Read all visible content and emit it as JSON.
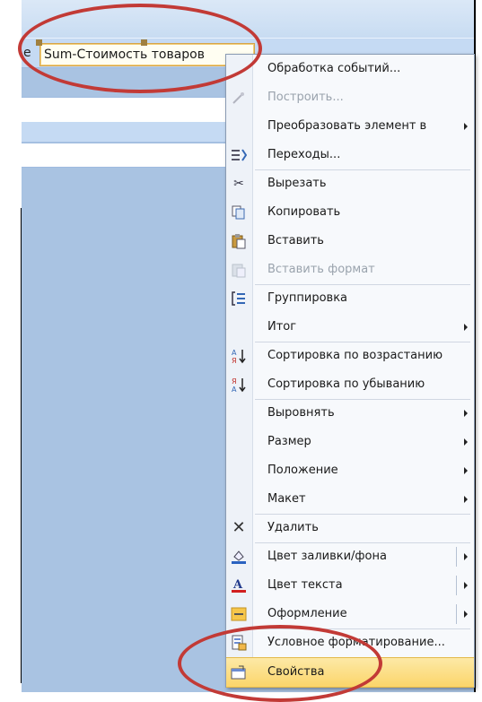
{
  "editor": {
    "left_label": "e",
    "field_text": "Sum-Стоимость товаров"
  },
  "menu": {
    "items": [
      {
        "label": "Обработка событий...",
        "icon": "none",
        "submenu": false,
        "state": "normal"
      },
      {
        "label": "Построить...",
        "icon": "build-wand-icon",
        "submenu": false,
        "state": "disabled"
      },
      {
        "label": "Преобразовать элемент в",
        "icon": "none",
        "submenu": true,
        "state": "normal"
      },
      {
        "label": "Переходы...",
        "icon": "tab-order-icon",
        "submenu": false,
        "state": "normal"
      },
      {
        "label": "Вырезать",
        "icon": "scissors-icon",
        "submenu": false,
        "state": "normal"
      },
      {
        "label": "Копировать",
        "icon": "copy-icon",
        "submenu": false,
        "state": "normal"
      },
      {
        "label": "Вставить",
        "icon": "paste-icon",
        "submenu": false,
        "state": "normal"
      },
      {
        "label": "Вставить формат",
        "icon": "paste-format-icon",
        "submenu": false,
        "state": "disabled"
      },
      {
        "label": "Группировка",
        "icon": "grouping-icon",
        "submenu": false,
        "state": "normal"
      },
      {
        "label": "Итог",
        "icon": "none",
        "submenu": true,
        "state": "normal"
      },
      {
        "label": "Сортировка по возрастанию",
        "icon": "sort-ascending-icon",
        "submenu": false,
        "state": "normal"
      },
      {
        "label": "Сортировка по убыванию",
        "icon": "sort-descending-icon",
        "submenu": false,
        "state": "normal"
      },
      {
        "label": "Выровнять",
        "icon": "none",
        "submenu": true,
        "state": "normal"
      },
      {
        "label": "Размер",
        "icon": "none",
        "submenu": true,
        "state": "normal"
      },
      {
        "label": "Положение",
        "icon": "none",
        "submenu": true,
        "state": "normal"
      },
      {
        "label": "Макет",
        "icon": "none",
        "submenu": true,
        "state": "normal"
      },
      {
        "label": "Удалить",
        "icon": "delete-x-icon",
        "submenu": false,
        "state": "normal"
      },
      {
        "label": "Цвет заливки/фона",
        "icon": "fill-color-icon",
        "submenu": true,
        "state": "normal"
      },
      {
        "label": "Цвет текста",
        "icon": "font-color-icon",
        "submenu": true,
        "state": "normal"
      },
      {
        "label": "Оформление",
        "icon": "special-effect-icon",
        "submenu": true,
        "state": "normal"
      },
      {
        "label": "Условное форматирование...",
        "icon": "conditional-format-icon",
        "submenu": false,
        "state": "normal"
      },
      {
        "label": "Свойства",
        "icon": "properties-icon",
        "submenu": false,
        "state": "highlighted"
      }
    ]
  },
  "colors": {
    "highlight": "#fbd56a",
    "annotation_ellipse": "#c23a36",
    "background": "#a9c3e2"
  }
}
